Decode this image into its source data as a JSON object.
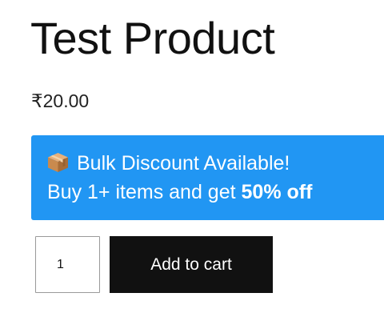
{
  "product": {
    "title": "Test Product",
    "price": "₹20.00"
  },
  "discount_notice": {
    "icon": "package-box-icon",
    "headline": "Bulk Discount Available!",
    "offer_prefix": "Buy 1+ items and get ",
    "offer_highlight": "50% off",
    "background_color": "#2196f3"
  },
  "cart_form": {
    "quantity_value": "1",
    "add_to_cart_label": "Add to cart",
    "button_color": "#111111"
  }
}
